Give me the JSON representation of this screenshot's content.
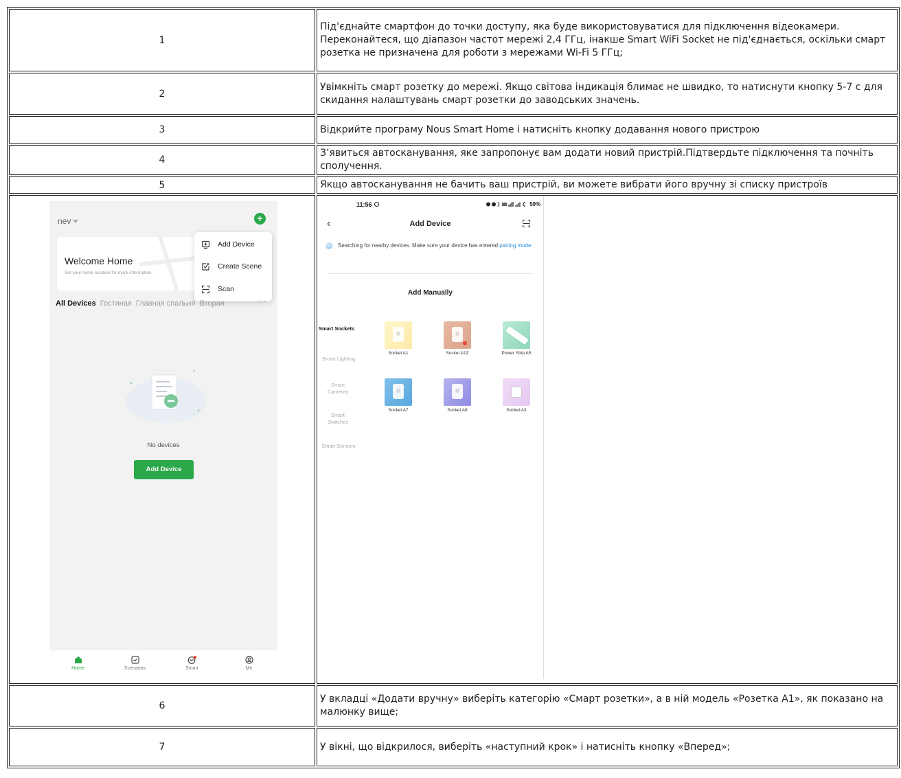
{
  "rows": [
    {
      "num": "1",
      "text": "Під'єднайте смартфон до точки доступу, яка буде використовуватися для підключення відеокамери. Переконайтеся, що діапазон частот мережі 2,4 ГГц, інакше Smart WiFi Socket не під'єднається, оскільки смарт розетка не призначена для роботи з мережами Wi-Fi 5 ГГц;"
    },
    {
      "num": "2",
      "text": "Увімкніть смарт розетку до мережі. Якщо світова індикація блимає не швидко, то натиснути кнопку 5-7 с для скидання налаштувань смарт розетки до заводських значень."
    },
    {
      "num": "3",
      "text": "Відкрийте програму Nous Smart Home і натисніть кнопку додавання нового пристрою"
    },
    {
      "num": "4",
      "text": "З’явиться автосканування, яке запропонує вам додати новий пристрій.Підтвердьте підключення та почніть сполучення."
    },
    {
      "num": "5",
      "text": "Якщо автосканування не бачить ваш пристрій, ви можете вибрати його вручну зі списку пристроїв"
    },
    {
      "num": "6",
      "text": "У вкладці «Додати вручну» виберіть категорію «Смарт розетки», а в ній модель «Розетка  А1», як показано на малюнку вище;"
    },
    {
      "num": "7",
      "text": "У вікні, що відкрилося, виберіть «наступний крок» і натисніть кнопку «Вперед»;"
    }
  ],
  "phone1": {
    "home_name": "nev",
    "welcome_title": "Welcome Home",
    "welcome_sub": "Set your home location for more information",
    "menu": {
      "add_device": "Add Device",
      "create_scene": "Create Scene",
      "scan": "Scan"
    },
    "tabs": {
      "all": "All Devices",
      "t1": "Гостиная",
      "t2": "Главная спальня",
      "t3": "Вторая",
      "more": "···"
    },
    "no_devices": "No devices",
    "add_device_btn": "Add Device",
    "bottom": {
      "home": "Home",
      "scenarios": "Scenarios",
      "smart": "Smart",
      "me": "Me"
    },
    "colors": {
      "accent": "#2aa84a",
      "badge": "#e8443a"
    }
  },
  "phone2": {
    "time": "11:56",
    "status_right": "59%",
    "title": "Add Device",
    "searching_text": "Searching for nearby devices. Make sure your device has entered ",
    "searching_link": "pairing mode.",
    "add_manually": "Add Manually",
    "categories": {
      "sockets": "Smart Sockets",
      "lighting": "Smart Lighting",
      "cameras": "Smart Cameras",
      "switches": "Smart Switches",
      "sensors": "Smart Sensors"
    },
    "products": {
      "a1": "Socket A1",
      "a1z": "Socket A1Z",
      "a5": "Power Strip A5",
      "a7": "Socket A7",
      "a8": "Socket A8",
      "a3": "Socket A3"
    },
    "colors": {
      "link": "#2b8ddb"
    }
  }
}
